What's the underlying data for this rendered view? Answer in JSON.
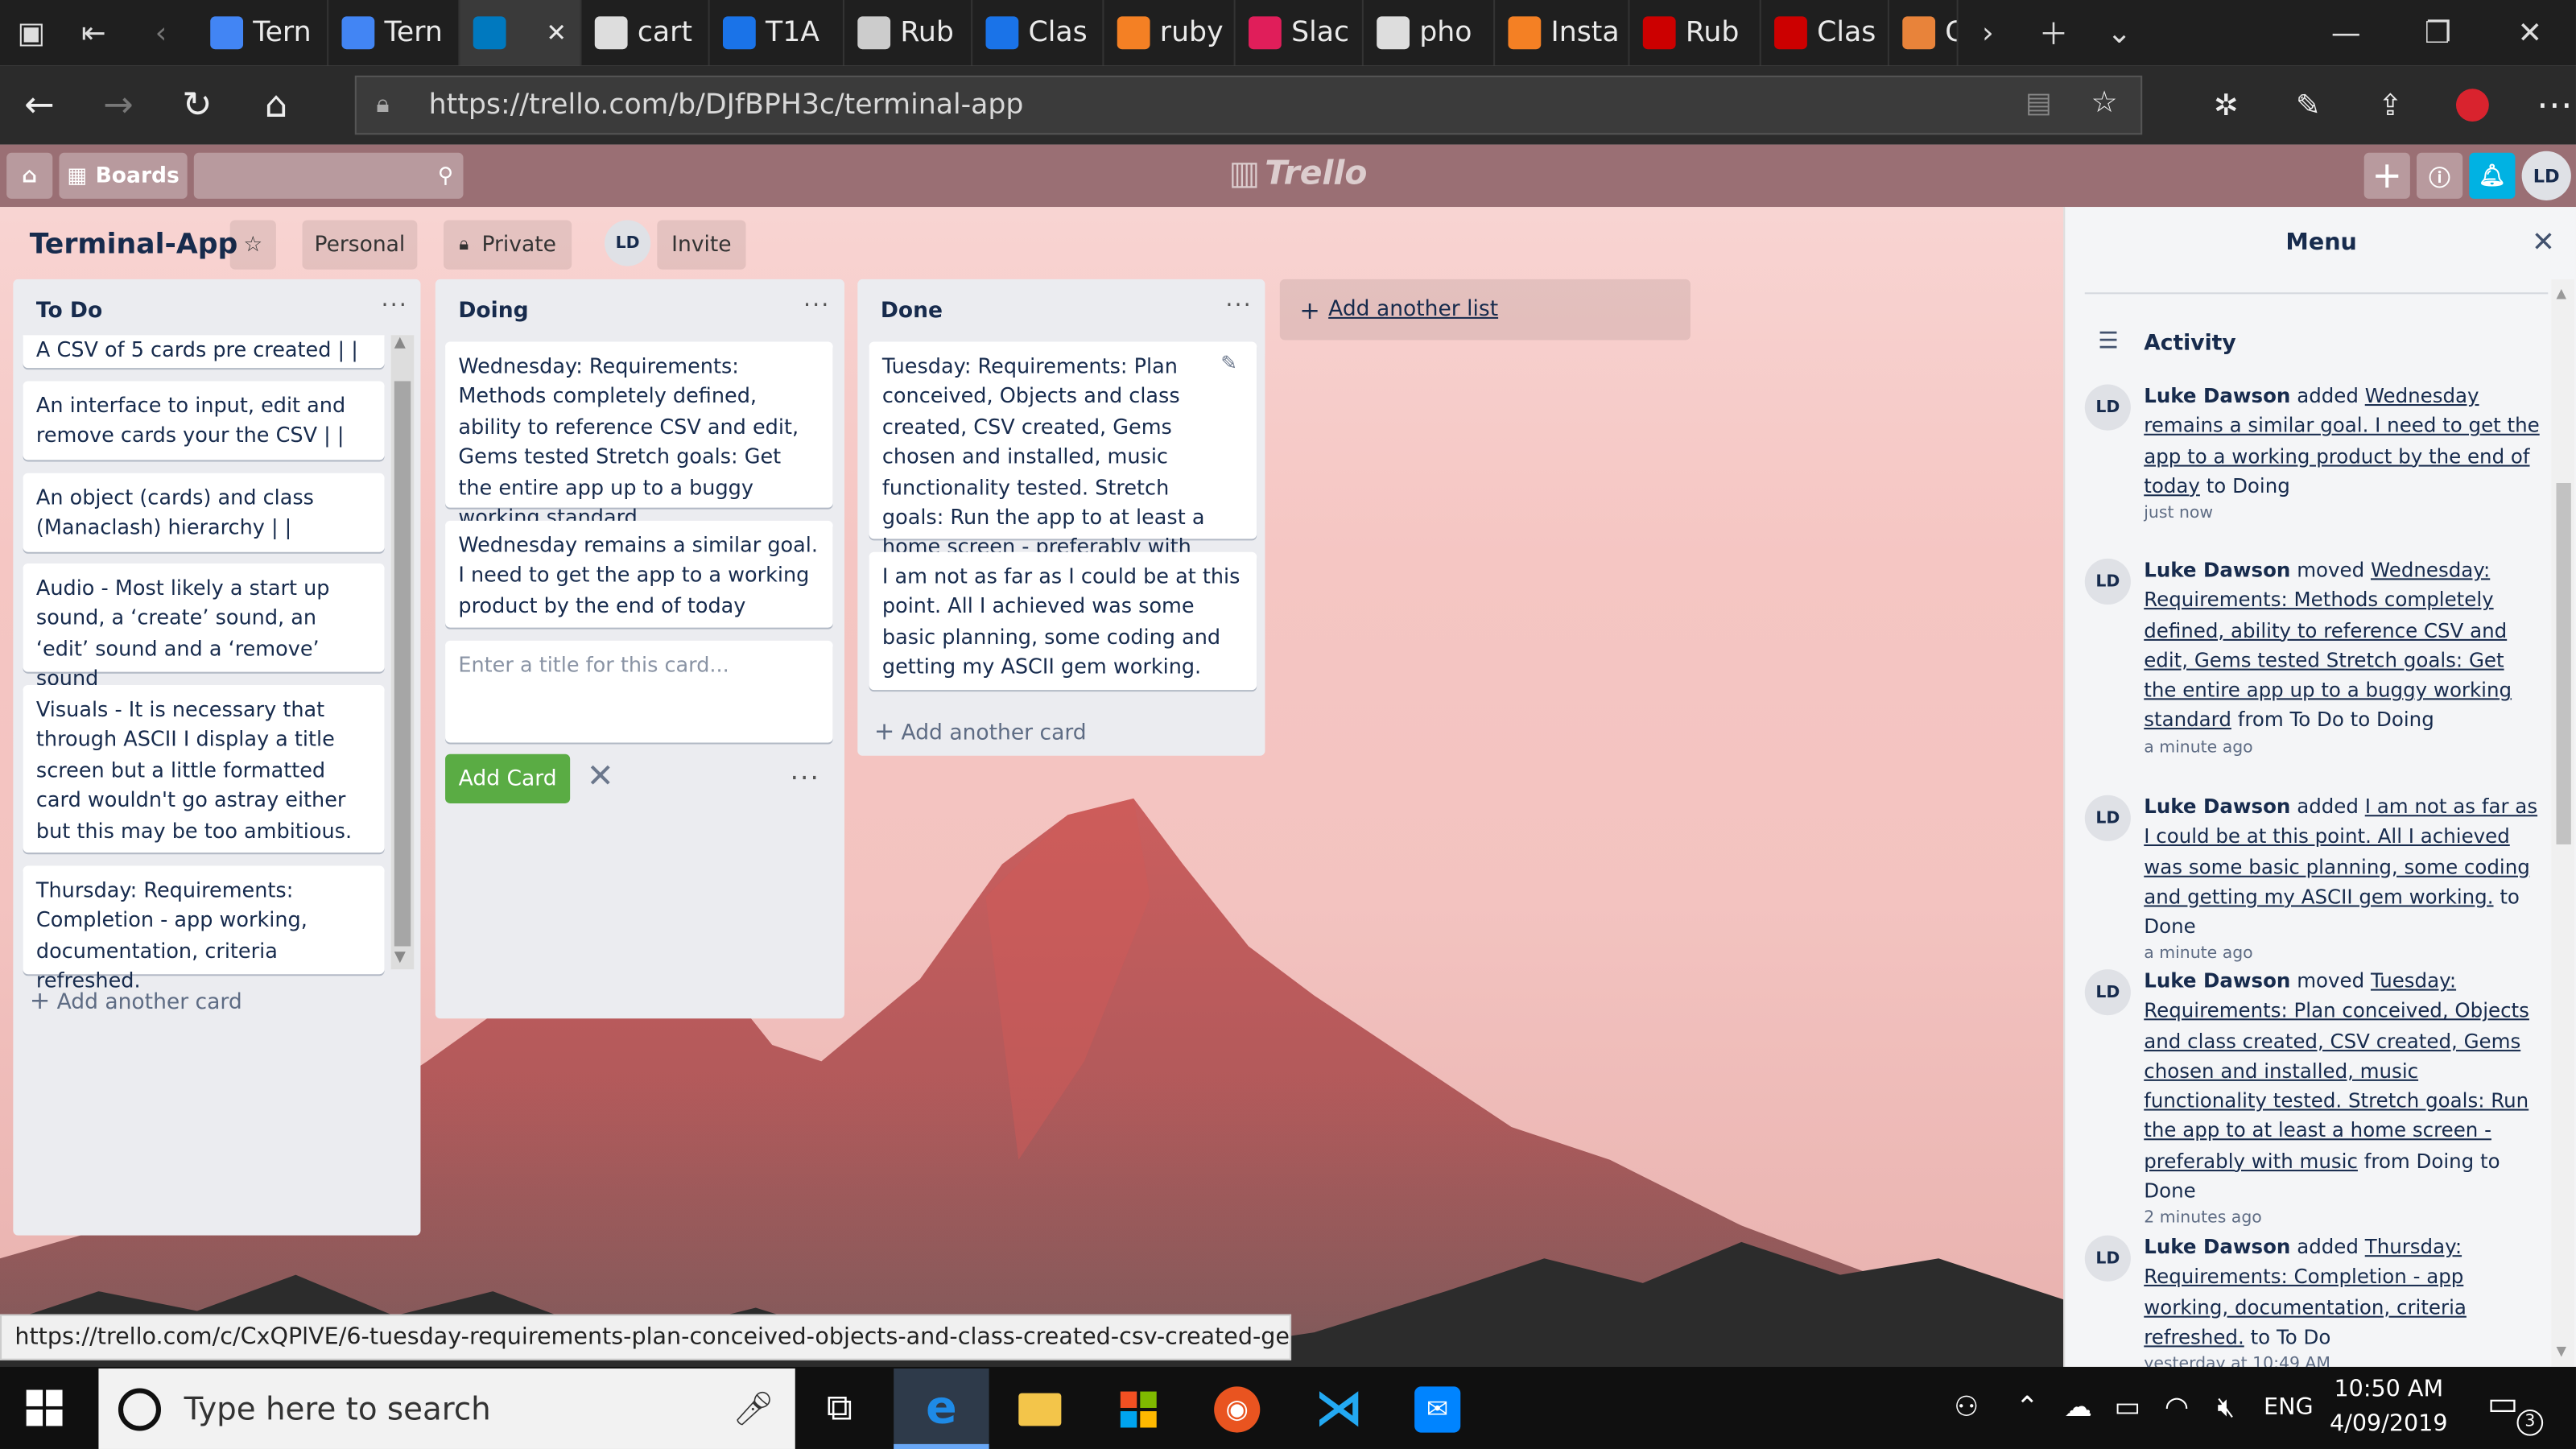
{
  "browser": {
    "tabs": [
      {
        "label": "",
        "icon": "window-icon"
      },
      {
        "label": "",
        "icon": "tab-actions-icon"
      },
      {
        "label": "",
        "icon": "back-tabs-icon"
      },
      {
        "label": "Tern",
        "icon": "docs-icon",
        "color": "#4285f4"
      },
      {
        "label": "Tern",
        "icon": "docs-icon",
        "color": "#4285f4"
      },
      {
        "label": "",
        "icon": "trello-icon",
        "color": "#0079bf",
        "active": true
      },
      {
        "label": "cart",
        "icon": "github-icon",
        "color": "#dddddd"
      },
      {
        "label": "T1A",
        "icon": "canvas-icon",
        "color": "#1a73e8"
      },
      {
        "label": "Rub",
        "icon": "search-page-icon",
        "color": "#cccccc"
      },
      {
        "label": "Clas",
        "icon": "canvas-icon",
        "color": "#1a73e8"
      },
      {
        "label": "ruby",
        "icon": "stackoverflow-icon",
        "color": "#f48024"
      },
      {
        "label": "Slac",
        "icon": "slack-icon",
        "color": "#e01e5a"
      },
      {
        "label": "pho",
        "icon": "github-icon",
        "color": "#dddddd"
      },
      {
        "label": "Insta",
        "icon": "stackoverflow-icon",
        "color": "#f48024"
      },
      {
        "label": "Rub",
        "icon": "ruby-icon",
        "color": "#cc0000"
      },
      {
        "label": "Clas",
        "icon": "ruby-icon",
        "color": "#cc0000"
      },
      {
        "label": "C",
        "icon": "app-icon",
        "color": "#e8833a"
      }
    ],
    "url": "https://trello.com/b/DJfBPH3c/terminal-app",
    "status_url": "https://trello.com/c/CxQPlVE/6-tuesday-requirements-plan-conceived-objects-and-class-created-csv-created-gems-ch"
  },
  "trello": {
    "boards_label": "Boards",
    "logo": "Trello",
    "avatar_initials": "LD",
    "board_title": "Terminal-App",
    "personal_label": "Personal",
    "private_label": "Private",
    "invite_label": "Invite",
    "add_list_label": "Add another list",
    "lists": [
      {
        "title": "To Do",
        "cards": [
          "A CSV of 5 cards pre created | |",
          "An interface to input, edit and remove cards your the CSV | |",
          "An object (cards) and class (Manaclash) hierarchy | |",
          "Audio - Most likely a start up sound, a ‘create’ sound, an ‘edit’ sound and a ‘remove’ sound",
          "Visuals - It is necessary that through ASCII I display a title screen but a little formatted card wouldn't go astray either but this may be too ambitious.",
          "Thursday: Requirements: Completion - app working, documentation, criteria refreshed."
        ],
        "add_card": "Add another card"
      },
      {
        "title": "Doing",
        "cards": [
          "Wednesday: Requirements: Methods completely defined, ability to reference CSV and edit, Gems tested Stretch goals: Get the entire app up to a buggy working standard",
          "Wednesday remains a similar goal. I need to get the app to a working product by the end of today"
        ],
        "new_card_placeholder": "Enter a title for this card...",
        "add_card_button": "Add Card"
      },
      {
        "title": "Done",
        "cards": [
          "Tuesday: Requirements: Plan conceived, Objects and class created, CSV created, Gems chosen and installed, music functionality tested. Stretch goals: Run the app to at least a home screen - preferably with music",
          "I am not as far as I could be at this point. All I achieved was some basic planning, some coding and getting my ASCII gem working."
        ],
        "add_card": "Add another card"
      }
    ],
    "menu": {
      "title": "Menu",
      "activity_heading": "Activity",
      "items": [
        {
          "user": "Luke Dawson",
          "verb": "added",
          "card": "Wednesday remains a similar goal. I need to get the app to a working product by the end of today",
          "suffix": "to Doing",
          "time": "just now"
        },
        {
          "user": "Luke Dawson",
          "verb": "moved",
          "card": "Wednesday: Requirements: Methods completely defined, ability to reference CSV and edit, Gems tested Stretch goals: Get the entire app up to a buggy working standard",
          "suffix": "from To Do to Doing",
          "time": "a minute ago"
        },
        {
          "user": "Luke Dawson",
          "verb": "added",
          "card": "I am not as far as I could be at this point. All I achieved was some basic planning, some coding and getting my ASCII gem working.",
          "suffix": "to Done",
          "time": "a minute ago"
        },
        {
          "user": "Luke Dawson",
          "verb": "moved",
          "card": "Tuesday: Requirements: Plan conceived, Objects and class created, CSV created, Gems chosen and installed, music functionality tested. Stretch goals: Run the app to at least a home screen - preferably with music",
          "suffix": "from Doing to Done",
          "time": "2 minutes ago"
        },
        {
          "user": "Luke Dawson",
          "verb": "added",
          "card": "Thursday: Requirements: Completion - app working, documentation, criteria refreshed.",
          "suffix": "to To Do",
          "time": "yesterday at 10:49 AM"
        }
      ]
    }
  },
  "taskbar": {
    "search_placeholder": "Type here to search",
    "language": "ENG",
    "time": "10:50 AM",
    "date": "4/09/2019",
    "notification_count": "3"
  }
}
